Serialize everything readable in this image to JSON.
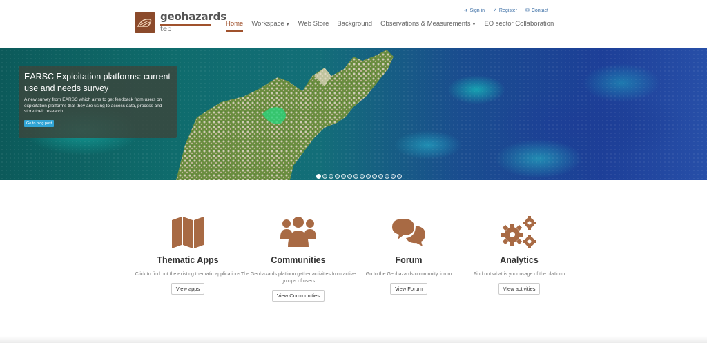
{
  "brand": {
    "name": "geohazards",
    "sub": "tep",
    "logo_icon": "geohazards-logo-icon"
  },
  "top_links": [
    {
      "label": "Sign in",
      "icon": "sign-in-icon"
    },
    {
      "label": "Register",
      "icon": "external-link-icon"
    },
    {
      "label": "Contact",
      "icon": "envelope-icon"
    }
  ],
  "nav": [
    {
      "label": "Home",
      "active": true,
      "dropdown": false
    },
    {
      "label": "Workspace",
      "active": false,
      "dropdown": true
    },
    {
      "label": "Web Store",
      "active": false,
      "dropdown": false
    },
    {
      "label": "Background",
      "active": false,
      "dropdown": false
    },
    {
      "label": "Observations & Measurements",
      "active": false,
      "dropdown": true
    },
    {
      "label": "EO sector Collaboration",
      "active": false,
      "dropdown": false
    }
  ],
  "hero": {
    "title": "EARSC Exploitation platforms: current use and needs survey",
    "text": "A new survey from EARSC which aims to get feedback from users on exploitation platforms that they are using to access data, process and store their research.",
    "button": "Go to blog post",
    "slide_count": 14,
    "active_slide": 1
  },
  "features": [
    {
      "title": "Thematic Apps",
      "desc": "Click to find out the existing thematic applications",
      "button": "View apps",
      "icon": "map-icon"
    },
    {
      "title": "Communities",
      "desc": "The Geohazards platform gather activities from active groups of users",
      "button": "View Communities",
      "icon": "users-icon"
    },
    {
      "title": "Forum",
      "desc": "Go to the Geohazards community forum",
      "button": "View Forum",
      "icon": "comments-icon"
    },
    {
      "title": "Analytics",
      "desc": "Find out what is your usage of the platform",
      "button": "View activities",
      "icon": "gears-icon"
    }
  ],
  "colors": {
    "accent": "#a0522d",
    "icon": "#a86a44",
    "link": "#3b6ea5"
  }
}
